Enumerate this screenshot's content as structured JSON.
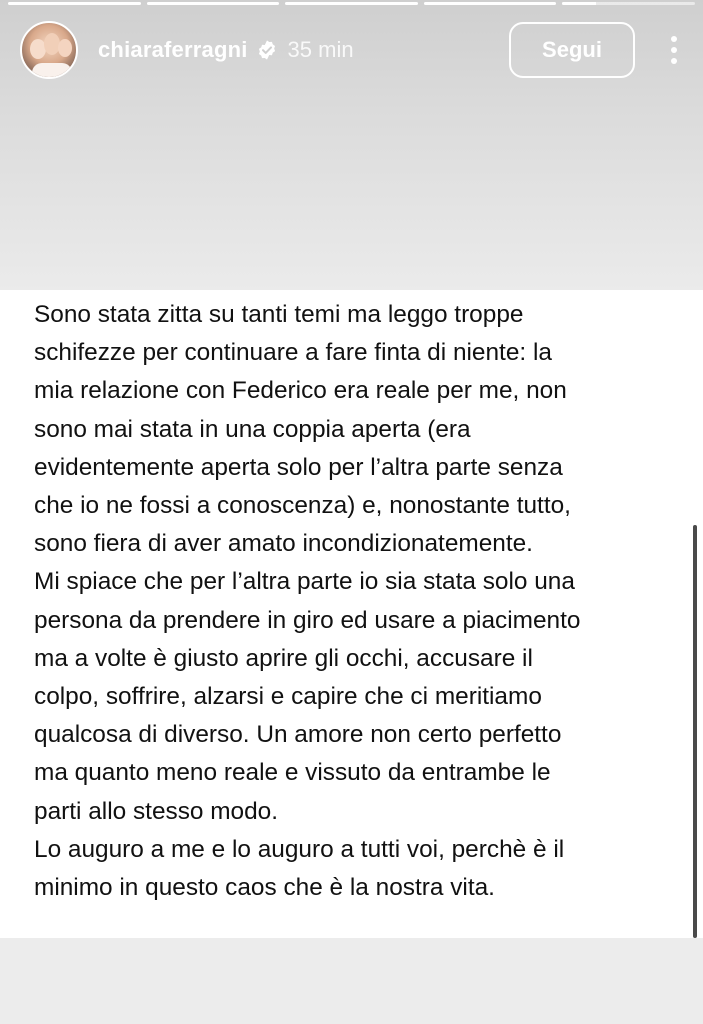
{
  "story": {
    "progress_segments": [
      1,
      1,
      1,
      1,
      0.25
    ]
  },
  "header": {
    "username": "chiaraferragni",
    "time": "35 min",
    "follow_label": "Segui",
    "verified_icon": "verified-badge-icon",
    "more_icon": "more-vertical-icon"
  },
  "post": {
    "paragraph_1": "Sono stata zitta su tanti temi ma leggo troppe\nschifezze per continuare a fare finta di niente: la\nmia relazione con Federico era reale per me, non\nsono mai stata in una coppia aperta (era\nevidentemente aperta solo per l’altra parte senza\nche io ne fossi a conoscenza) e, nonostante tutto,\nsono fiera di aver amato incondizionatemente.",
    "paragraph_2": "Mi spiace che per l’altra parte io sia stata solo una\npersona da prendere in giro ed usare a piacimento\nma a volte è giusto aprire gli occhi, accusare il\ncolpo, soffrire, alzarsi e capire che ci meritiamo\nqualcosa di diverso. Un amore non certo perfetto\nma quanto meno reale e vissuto da entrambe le\nparti allo stesso modo.",
    "paragraph_3": "Lo auguro a me e lo auguro a tutti voi, perchè è il\nminimo in questo caos che è la nostra vita."
  },
  "colors": {
    "text": "#111111",
    "card_bg": "#ffffff",
    "page_bg": "#ececec",
    "header_text": "#ffffff"
  }
}
